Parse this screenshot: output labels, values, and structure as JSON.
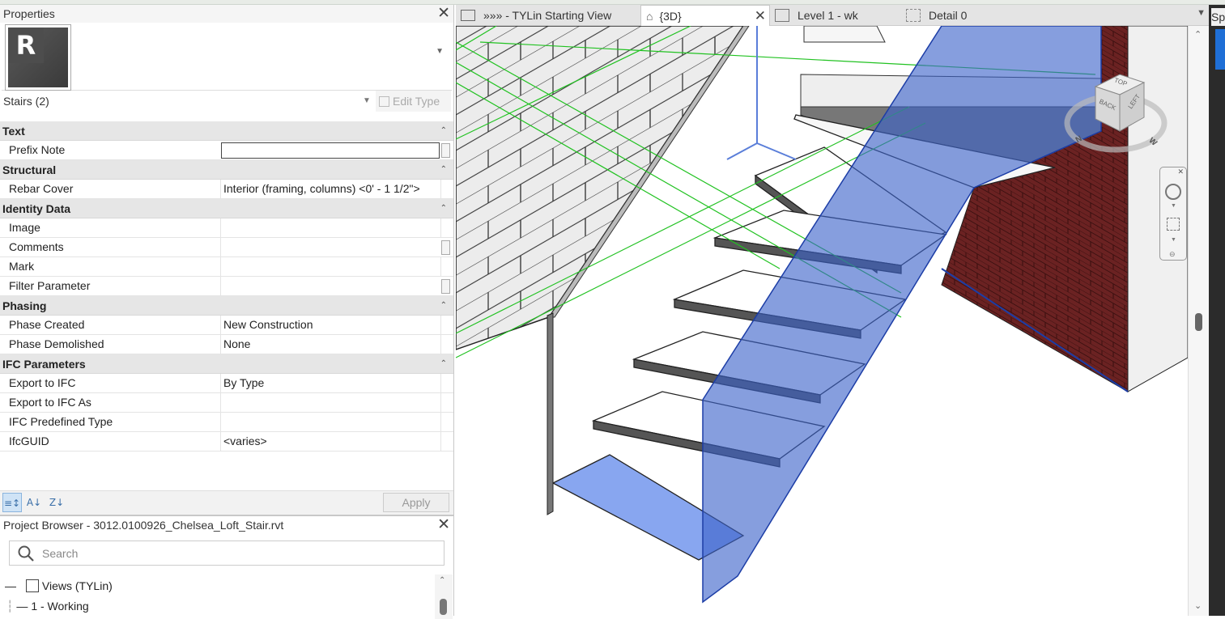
{
  "properties": {
    "title": "Properties",
    "type_selector": "Stairs (2)",
    "edit_type_label": "Edit Type",
    "groups": [
      {
        "name": "Text",
        "rows": [
          {
            "label": "Prefix Note",
            "value": ""
          }
        ]
      },
      {
        "name": "Structural",
        "rows": [
          {
            "label": "Rebar Cover",
            "value": "Interior (framing, columns) <0' - 1 1/2\">"
          }
        ]
      },
      {
        "name": "Identity Data",
        "rows": [
          {
            "label": "Image",
            "value": ""
          },
          {
            "label": "Comments",
            "value": ""
          },
          {
            "label": "Mark",
            "value": ""
          },
          {
            "label": "Filter Parameter",
            "value": ""
          }
        ]
      },
      {
        "name": "Phasing",
        "rows": [
          {
            "label": "Phase Created",
            "value": "New Construction"
          },
          {
            "label": "Phase Demolished",
            "value": "None"
          }
        ]
      },
      {
        "name": "IFC Parameters",
        "rows": [
          {
            "label": "Export to IFC",
            "value": "By Type"
          },
          {
            "label": "Export to IFC As",
            "value": ""
          },
          {
            "label": "IFC Predefined Type",
            "value": ""
          },
          {
            "label": "IfcGUID",
            "value": "<varies>"
          }
        ]
      }
    ],
    "apply_label": "Apply"
  },
  "browser": {
    "title": "Project Browser - 3012.0100926_Chelsea_Loft_Stair.rvt",
    "search_placeholder": "Search",
    "tree": [
      {
        "label": "Views (TYLin)"
      },
      {
        "label": "1 - Working"
      }
    ]
  },
  "tabs": [
    {
      "label": "»»» - TYLin Starting View"
    },
    {
      "label": "{3D}"
    },
    {
      "label": "Level 1 - wk"
    },
    {
      "label": "Detail 0"
    }
  ],
  "viewcube": {
    "face_back": "BACK",
    "face_left": "LEFT",
    "face_top": "TOP",
    "compass_n": "N",
    "compass_w": "W"
  },
  "right_panel_label": "Sp",
  "colors": {
    "accent_blue": "#3b63c9",
    "brick": "#6b2222",
    "grid_green": "#21c221",
    "selected_tab": "#ffffff"
  }
}
